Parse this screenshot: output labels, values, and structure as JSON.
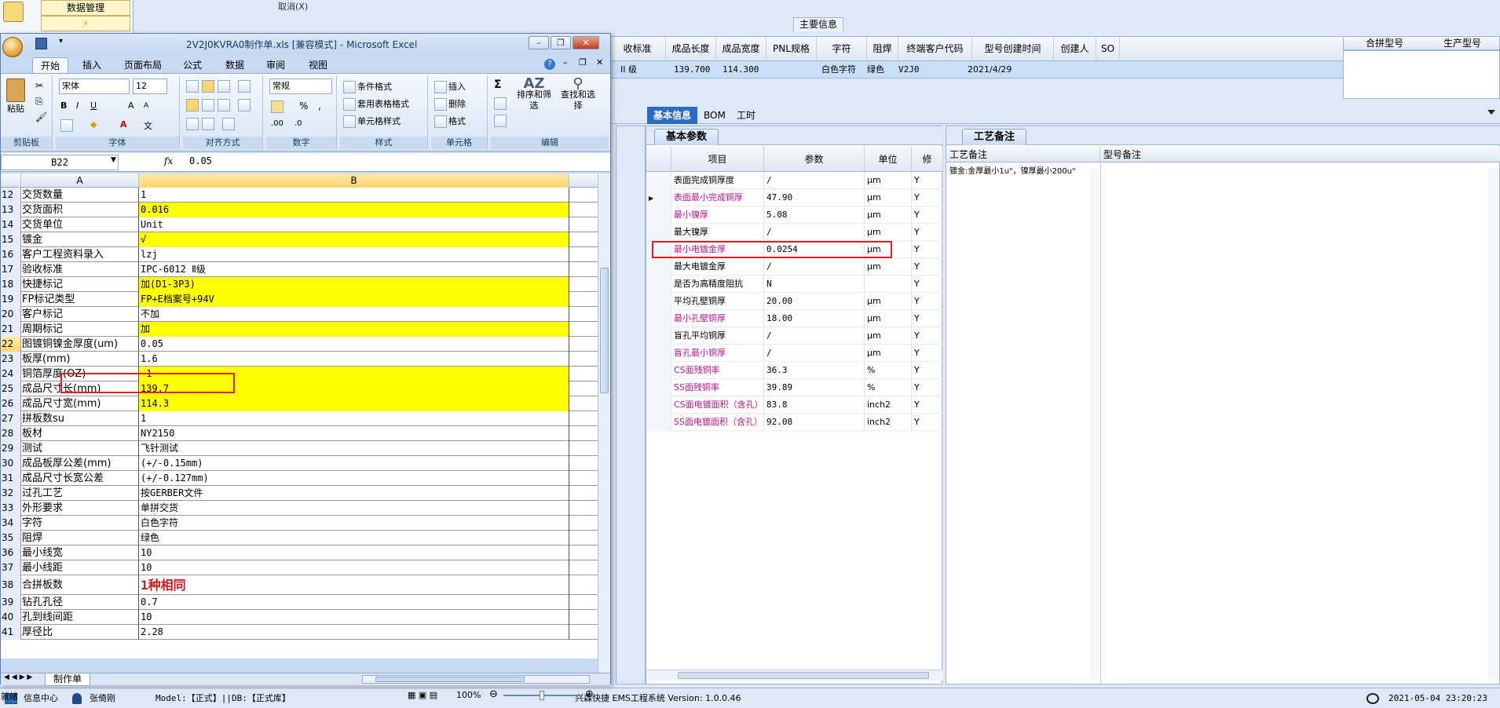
{
  "erp": {
    "nav_item": "数据管理",
    "top_label": "取消(X)",
    "main_tab": "主要信息",
    "grid_headers": [
      "收标准",
      "成品长度",
      "成品宽度",
      "PNL规格",
      "字符",
      "阻焊",
      "终端客户代码",
      "型号创建时间",
      "创建人",
      "SO"
    ],
    "grid_row": [
      "II 级",
      "139.700",
      "114.300",
      "",
      "白色字符",
      "绿色",
      "V2J0",
      "2021/4/29",
      "",
      ""
    ],
    "right_headers": [
      "合拼型号",
      "生产型号"
    ],
    "tabs": [
      "基本信息",
      "BOM",
      "工时"
    ],
    "param_subtab": "基本参数",
    "param_headers": [
      "项目",
      "参数",
      "单位",
      "修"
    ],
    "param_rows": [
      {
        "name": "表面完成铜厚度",
        "value": "/",
        "unit": "μm",
        "flag": "Y",
        "pink": false,
        "current": false
      },
      {
        "name": "表面最小完成铜厚",
        "value": "47.90",
        "unit": "μm",
        "flag": "Y",
        "pink": true,
        "current": true
      },
      {
        "name": "最小镍厚",
        "value": "5.08",
        "unit": "μm",
        "flag": "Y",
        "pink": true,
        "current": false
      },
      {
        "name": "最大镍厚",
        "value": "/",
        "unit": "μm",
        "flag": "Y",
        "pink": false,
        "current": false
      },
      {
        "name": "最小电镀金厚",
        "value": "0.0254",
        "unit": "μm",
        "flag": "Y",
        "pink": true,
        "current": false
      },
      {
        "name": "最大电镀金厚",
        "value": "/",
        "unit": "μm",
        "flag": "Y",
        "pink": false,
        "current": false
      },
      {
        "name": "是否为高精度阻抗",
        "value": "N",
        "unit": "",
        "flag": "Y",
        "pink": false,
        "current": false
      },
      {
        "name": "平均孔壁铜厚",
        "value": "20.00",
        "unit": "μm",
        "flag": "Y",
        "pink": false,
        "current": false
      },
      {
        "name": "最小孔壁铜厚",
        "value": "18.00",
        "unit": "μm",
        "flag": "Y",
        "pink": true,
        "current": false
      },
      {
        "name": "盲孔平均铜厚",
        "value": "/",
        "unit": "μm",
        "flag": "Y",
        "pink": false,
        "current": false
      },
      {
        "name": "盲孔最小铜厚",
        "value": "/",
        "unit": "μm",
        "flag": "Y",
        "pink": true,
        "current": false
      },
      {
        "name": "CS面残铜率",
        "value": "36.3",
        "unit": "%",
        "flag": "Y",
        "pink": true,
        "current": false
      },
      {
        "name": "SS面残铜率",
        "value": "39.89",
        "unit": "%",
        "flag": "Y",
        "pink": true,
        "current": false
      },
      {
        "name": "CS面电镀面积（含孔）",
        "value": "83.8",
        "unit": "inch2",
        "flag": "Y",
        "pink": true,
        "current": false
      },
      {
        "name": "SS面电镀面积（含孔）",
        "value": "92.08",
        "unit": "inch2",
        "flag": "Y",
        "pink": true,
        "current": false
      }
    ],
    "note_subtab": "工艺备注",
    "note_headers": [
      "工艺备注",
      "型号备注"
    ],
    "note_text": "镀金:金厚最小1u\"，镍厚最小200u\""
  },
  "statusbar": {
    "info_center": "信息中心",
    "user": "张倚刚",
    "model": "Model:【正式】||DB:【正式库】",
    "system": "兴森快捷 EMS工程系统 Version: 1.0.0.46",
    "datetime": "2021-05-04 23:20:23"
  },
  "excel": {
    "title": "2V2J0KVRA0制作单.xls [兼容模式] - Microsoft Excel",
    "tabs": [
      "开始",
      "插入",
      "页面布局",
      "公式",
      "数据",
      "审阅",
      "视图"
    ],
    "ribbon": {
      "paste": "粘贴",
      "clipboard": "剪贴板",
      "font_name": "宋体",
      "font_size": "12",
      "font_group": "字体",
      "align_group": "对齐方式",
      "number_format": "常规",
      "number_group": "数字",
      "cond_format": "条件格式",
      "table_format": "套用表格格式",
      "cell_style": "单元格样式",
      "style_group": "样式",
      "insert": "插入",
      "delete": "删除",
      "format": "格式",
      "cells_group": "单元格",
      "sort_filter": "排序和筛选",
      "find_select": "查找和选择",
      "edit_group": "编辑"
    },
    "name_box": "B22",
    "fx": "fx",
    "formula_value": "0.05",
    "columns": [
      "A",
      "B"
    ],
    "rows": [
      {
        "n": "12",
        "a": "交货数量",
        "b": "1",
        "y": false
      },
      {
        "n": "13",
        "a": "交货面积",
        "b": "0.016",
        "y": true
      },
      {
        "n": "14",
        "a": "交货单位",
        "b": "Unit",
        "y": false
      },
      {
        "n": "15",
        "a": "镀金",
        "b": "√",
        "y": true
      },
      {
        "n": "16",
        "a": "客户工程资料录入",
        "b": "lzj",
        "y": false
      },
      {
        "n": "17",
        "a": "验收标准",
        "b": "IPC-6012 Ⅱ级",
        "y": false
      },
      {
        "n": "18",
        "a": "快捷标记",
        "b": "加(D1-3P3)",
        "y": true
      },
      {
        "n": "19",
        "a": "FP标记类型",
        "b": "FP+E档案号+94V",
        "y": true
      },
      {
        "n": "20",
        "a": "客户标记",
        "b": "不加",
        "y": false
      },
      {
        "n": "21",
        "a": "周期标记",
        "b": "加",
        "y": true
      },
      {
        "n": "22",
        "a": "图镀铜镍金厚度(um)",
        "b": "0.05",
        "y": false
      },
      {
        "n": "23",
        "a": "板厚(mm)",
        "b": "1.6",
        "y": false
      },
      {
        "n": "24",
        "a": "铜箔厚度(OZ)",
        "b": "-1",
        "y": true
      },
      {
        "n": "25",
        "a": "成品尺寸长(mm)",
        "b": "139.7",
        "y": true
      },
      {
        "n": "26",
        "a": "成品尺寸宽(mm)",
        "b": "114.3",
        "y": true
      },
      {
        "n": "27",
        "a": "拼板数su",
        "b": "1",
        "y": false
      },
      {
        "n": "28",
        "a": "板材",
        "b": "NY2150",
        "y": false
      },
      {
        "n": "29",
        "a": "测试",
        "b": "飞针测试",
        "y": false
      },
      {
        "n": "30",
        "a": "成品板厚公差(mm)",
        "b": "(+/-0.15mm)",
        "y": false
      },
      {
        "n": "31",
        "a": "成品尺寸长宽公差",
        "b": "(+/-0.127mm)",
        "y": false
      },
      {
        "n": "32",
        "a": "过孔工艺",
        "b": "按GERBER文件",
        "y": false
      },
      {
        "n": "33",
        "a": "外形要求",
        "b": "单拼交货",
        "y": false
      },
      {
        "n": "34",
        "a": "字符",
        "b": "白色字符",
        "y": false
      },
      {
        "n": "35",
        "a": "阻焊",
        "b": "绿色",
        "y": false
      },
      {
        "n": "36",
        "a": "最小线宽",
        "b": "10",
        "y": false
      },
      {
        "n": "37",
        "a": "最小线距",
        "b": "10",
        "y": false
      },
      {
        "n": "38",
        "a": "合拼板数",
        "b": "1种相同",
        "y": false,
        "big": true
      },
      {
        "n": "39",
        "a": "钻孔孔径",
        "b": "0.7",
        "y": false
      },
      {
        "n": "40",
        "a": "孔到线间距",
        "b": "10",
        "y": false
      },
      {
        "n": "41",
        "a": "厚径比",
        "b": "2.28",
        "y": false
      }
    ],
    "sheet_tab": "制作单",
    "status_ready": "就绪",
    "zoom": "100%"
  }
}
